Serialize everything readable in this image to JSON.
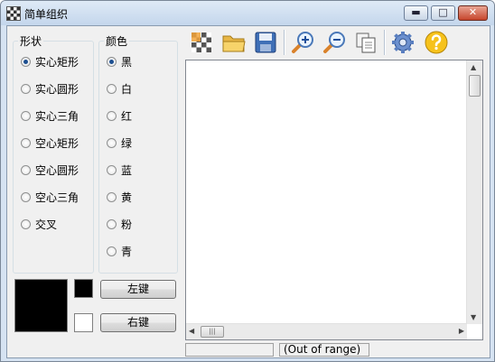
{
  "window": {
    "title": "简单组织",
    "controls": {
      "minimize": "▬",
      "maximize": "□",
      "close": "✕"
    }
  },
  "shape_group": {
    "title": "形状",
    "selected_index": 0,
    "options": [
      "实心矩形",
      "实心圆形",
      "实心三角",
      "空心矩形",
      "空心圆形",
      "空心三角",
      "交叉"
    ]
  },
  "color_group": {
    "title": "颜色",
    "selected_index": 0,
    "options": [
      "黑",
      "白",
      "红",
      "绿",
      "蓝",
      "黄",
      "粉",
      "青"
    ]
  },
  "color_picker": {
    "primary_color": "#000000",
    "secondary_color": "#ffffff",
    "left_button": "左键",
    "right_button": "右键"
  },
  "toolbar": {
    "items": [
      "checkerboard-icon",
      "open-folder-icon",
      "save-icon",
      "zoom-in-icon",
      "zoom-out-icon",
      "copy-icon",
      "settings-gear-icon",
      "help-icon"
    ]
  },
  "status": {
    "left": "",
    "coordinates": "(Out of range)"
  }
}
